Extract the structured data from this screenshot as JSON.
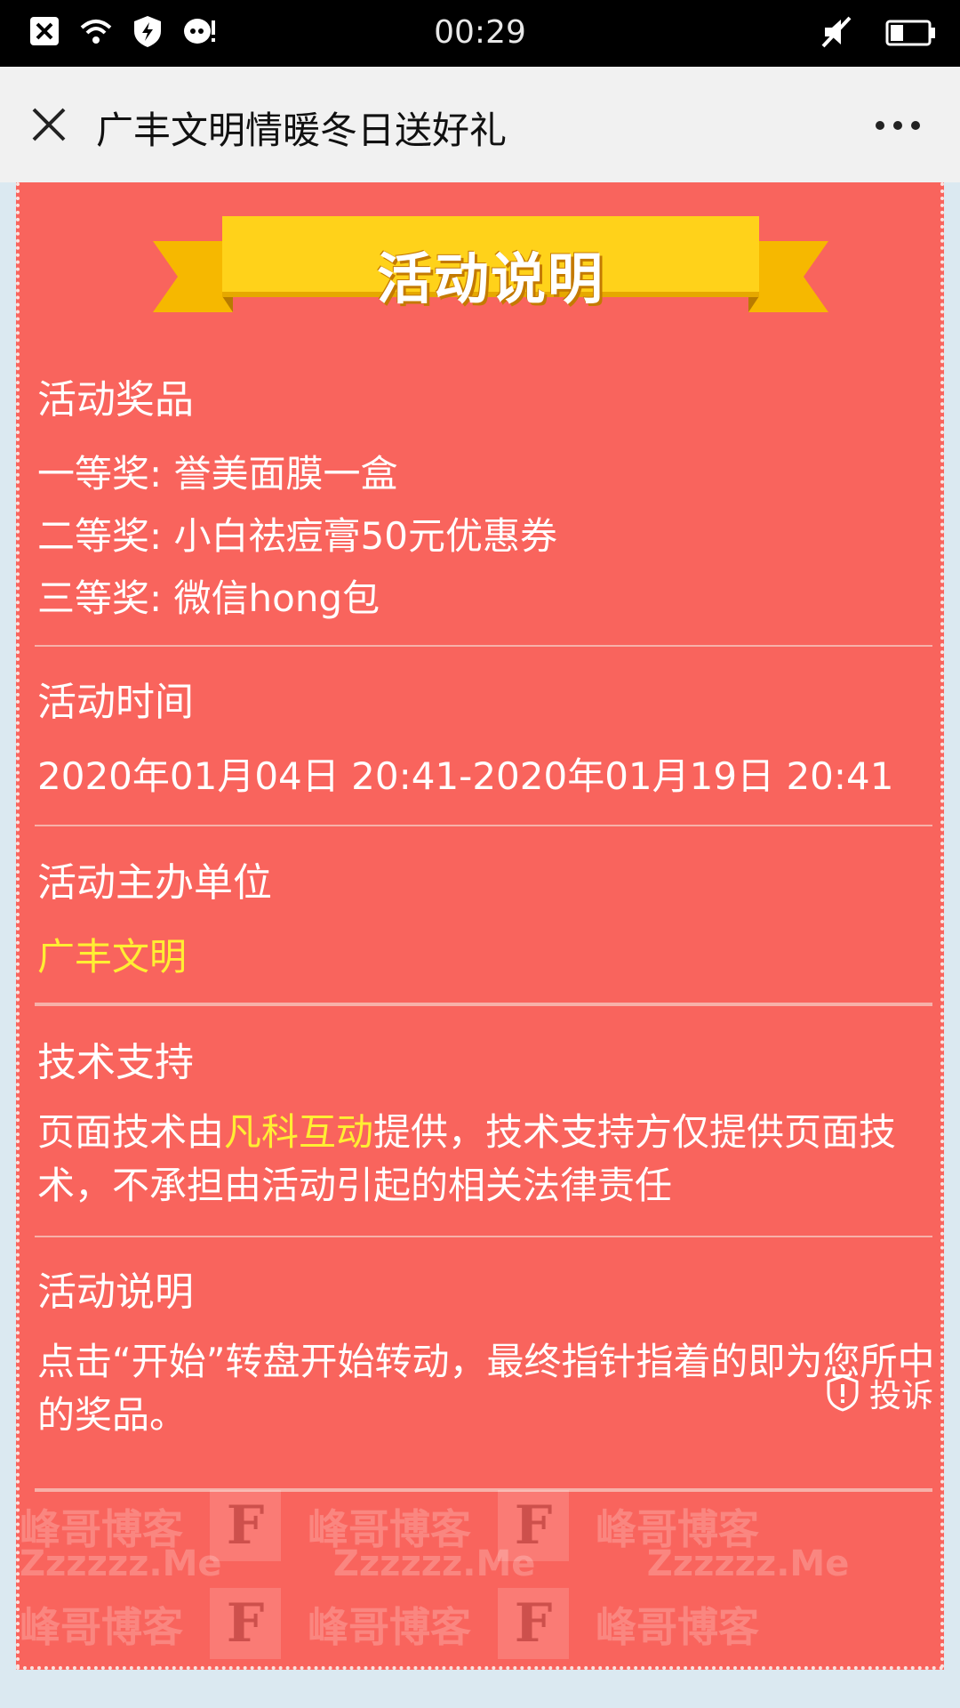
{
  "status_bar": {
    "time": "00:29"
  },
  "nav": {
    "title": "广丰文明情暖冬日送好礼"
  },
  "banner": {
    "title": "活动说明"
  },
  "sections": {
    "prizes": {
      "title": "活动奖品",
      "lines": [
        "一等奖: 誉美面膜一盒",
        "二等奖: 小白祛痘膏50元优惠券",
        "三等奖: 微信hong包"
      ]
    },
    "time": {
      "title": "活动时间",
      "value": "2020年01月04日 20:41-2020年01月19日 20:41"
    },
    "organizer": {
      "title": "活动主办单位",
      "value": "广丰文明"
    },
    "tech": {
      "title": "技术支持",
      "text_before": "页面技术由",
      "highlight": "凡科互动",
      "text_after": "提供，技术支持方仅提供页面技术，不承担由活动引起的相关法律责任"
    },
    "rules": {
      "title": "活动说明",
      "text": "点击“开始”转盘开始转动，最终指针指着的即为您所中的奖品。"
    }
  },
  "watermark": {
    "brand": "峰哥博客",
    "url": "Zzzzzz.Me",
    "logo_letter": "F"
  },
  "complain": {
    "label": "投诉"
  }
}
